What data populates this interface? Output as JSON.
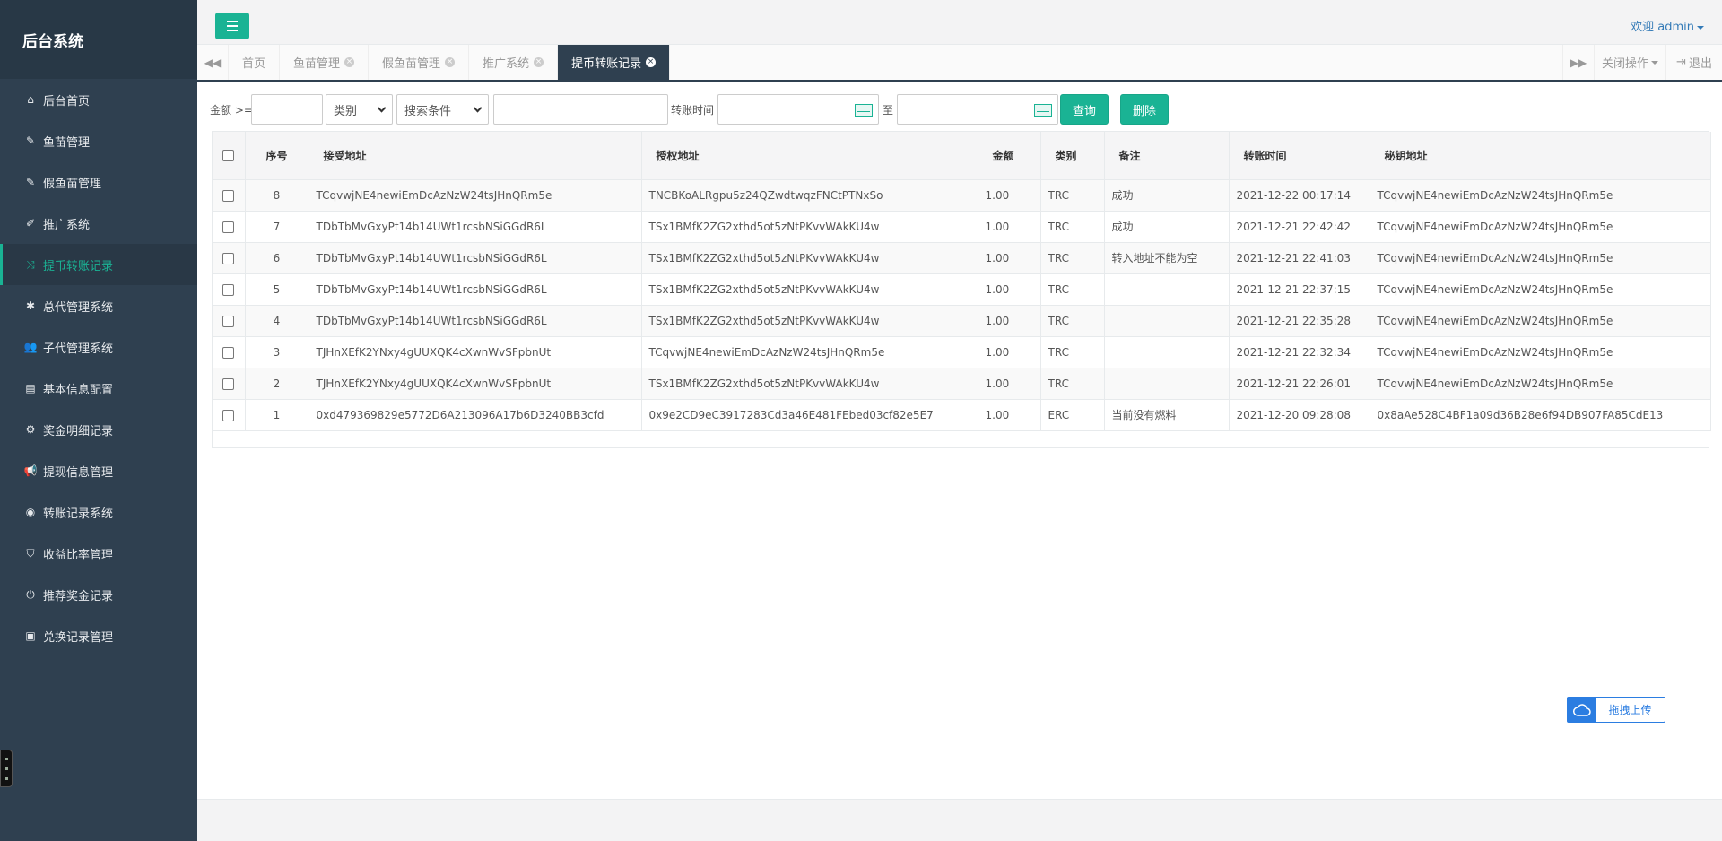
{
  "sidebar": {
    "brand": "后台系统",
    "items": [
      {
        "label": "后台首页",
        "icon": "home-icon"
      },
      {
        "label": "鱼苗管理",
        "icon": "wrench-icon"
      },
      {
        "label": "假鱼苗管理",
        "icon": "wrench-icon"
      },
      {
        "label": "推广系统",
        "icon": "edit-icon"
      },
      {
        "label": "提币转账记录",
        "icon": "shuffle-icon"
      },
      {
        "label": "总代管理系统",
        "icon": "asterisk-icon"
      },
      {
        "label": "子代管理系统",
        "icon": "users-icon"
      },
      {
        "label": "基本信息配置",
        "icon": "file-icon"
      },
      {
        "label": "奖金明细记录",
        "icon": "gears-icon"
      },
      {
        "label": "提现信息管理",
        "icon": "bullhorn-icon"
      },
      {
        "label": "转账记录系统",
        "icon": "dashboard-icon"
      },
      {
        "label": "收益比率管理",
        "icon": "shield-icon"
      },
      {
        "label": "推荐奖金记录",
        "icon": "power-icon"
      },
      {
        "label": "兑换记录管理",
        "icon": "save-icon"
      }
    ]
  },
  "header": {
    "welcome": "欢迎",
    "user": "admin"
  },
  "tabs": [
    {
      "label": "首页"
    },
    {
      "label": "鱼苗管理"
    },
    {
      "label": "假鱼苗管理"
    },
    {
      "label": "推广系统"
    },
    {
      "label": "提币转账记录"
    }
  ],
  "tabbar": {
    "close_ops": "关闭操作",
    "logout": "退出"
  },
  "search": {
    "amount_label": "金额 >=",
    "amount_value": "",
    "type_select": "类别",
    "condition_select": "搜索条件",
    "keyword_value": "",
    "time_label": "转账时间",
    "to_label": "至",
    "query_button": "查询",
    "delete_button": "删除"
  },
  "table": {
    "columns": [
      "序号",
      "接受地址",
      "授权地址",
      "金额",
      "类别",
      "备注",
      "转账时间",
      "秘钥地址"
    ],
    "rows": [
      [
        "8",
        "TCqvwjNE4newiEmDcAzNzW24tsJHnQRm5e",
        "TNCBKoALRgpu5z24QZwdtwqzFNCtPTNxSo",
        "1.00",
        "TRC",
        "成功",
        "2021-12-22 00:17:14",
        "TCqvwjNE4newiEmDcAzNzW24tsJHnQRm5e"
      ],
      [
        "7",
        "TDbTbMvGxyPt14b14UWt1rcsbNSiGGdR6L",
        "TSx1BMfK2ZG2xthd5ot5zNtPKvvWAkKU4w",
        "1.00",
        "TRC",
        "成功",
        "2021-12-21 22:42:42",
        "TCqvwjNE4newiEmDcAzNzW24tsJHnQRm5e"
      ],
      [
        "6",
        "TDbTbMvGxyPt14b14UWt1rcsbNSiGGdR6L",
        "TSx1BMfK2ZG2xthd5ot5zNtPKvvWAkKU4w",
        "1.00",
        "TRC",
        "转入地址不能为空",
        "2021-12-21 22:41:03",
        "TCqvwjNE4newiEmDcAzNzW24tsJHnQRm5e"
      ],
      [
        "5",
        "TDbTbMvGxyPt14b14UWt1rcsbNSiGGdR6L",
        "TSx1BMfK2ZG2xthd5ot5zNtPKvvWAkKU4w",
        "1.00",
        "TRC",
        "",
        "2021-12-21 22:37:15",
        "TCqvwjNE4newiEmDcAzNzW24tsJHnQRm5e"
      ],
      [
        "4",
        "TDbTbMvGxyPt14b14UWt1rcsbNSiGGdR6L",
        "TSx1BMfK2ZG2xthd5ot5zNtPKvvWAkKU4w",
        "1.00",
        "TRC",
        "",
        "2021-12-21 22:35:28",
        "TCqvwjNE4newiEmDcAzNzW24tsJHnQRm5e"
      ],
      [
        "3",
        "TJHnXEfK2YNxy4gUUXQK4cXwnWvSFpbnUt",
        "TCqvwjNE4newiEmDcAzNzW24tsJHnQRm5e",
        "1.00",
        "TRC",
        "",
        "2021-12-21 22:32:34",
        "TCqvwjNE4newiEmDcAzNzW24tsJHnQRm5e"
      ],
      [
        "2",
        "TJHnXEfK2YNxy4gUUXQK4cXwnWvSFpbnUt",
        "TSx1BMfK2ZG2xthd5ot5zNtPKvvWAkKU4w",
        "1.00",
        "TRC",
        "",
        "2021-12-21 22:26:01",
        "TCqvwjNE4newiEmDcAzNzW24tsJHnQRm5e"
      ],
      [
        "1",
        "0xd479369829e5772D6A213096A17b6D3240BB3cfd",
        "0x9e2CD9eC3917283Cd3a46E481FEbed03cf82e5E7",
        "1.00",
        "ERC",
        "当前没有燃料",
        "2021-12-20 09:28:08",
        "0x8aAe528C4BF1a09d36B28e6f94DB907FA85CdE13"
      ]
    ]
  },
  "upload": {
    "label": "拖拽上传"
  },
  "colors": {
    "accent": "#1ab394",
    "sidebar": "#2f4050",
    "link": "#337ab7",
    "upload": "#2b7de1"
  }
}
